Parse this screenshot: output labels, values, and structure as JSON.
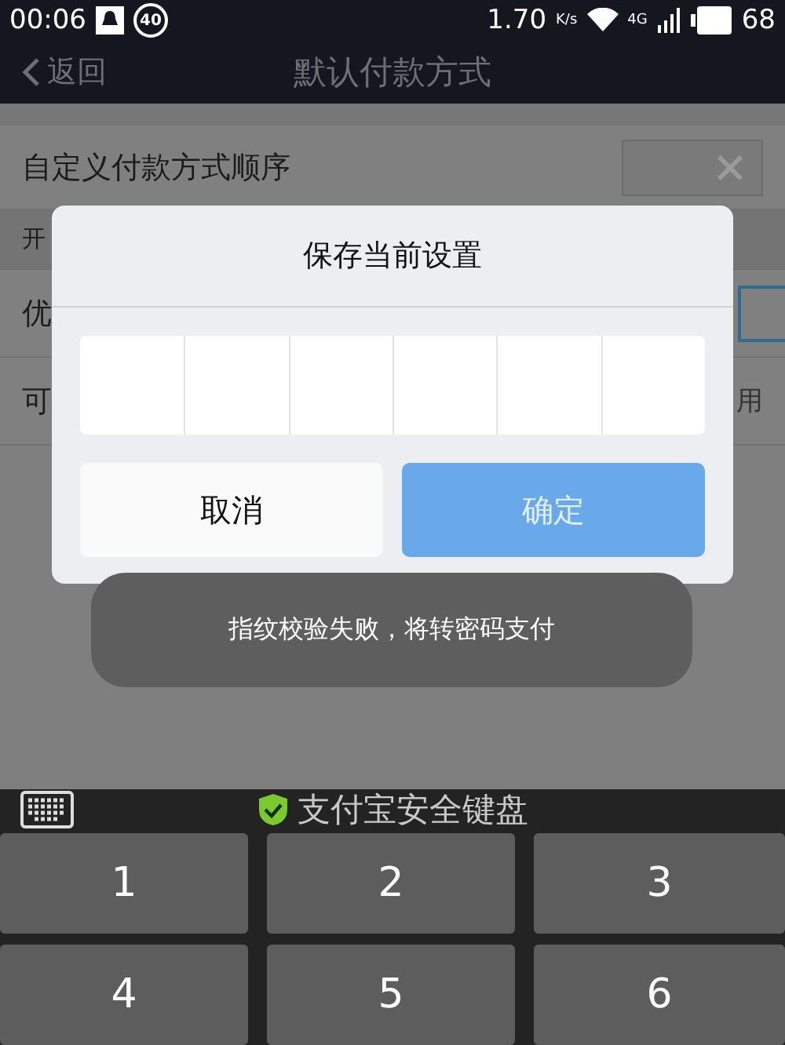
{
  "status_bar": {
    "time": "00:06",
    "badge": "40",
    "speed": "1.70",
    "speed_unit": "K/s",
    "network": "4G",
    "battery": "68"
  },
  "nav": {
    "back": "返回",
    "title": "默认付款方式"
  },
  "settings": [
    {
      "kind": "toggle",
      "label": "自定义付款方式顺序",
      "on": false
    },
    {
      "kind": "hint",
      "label": "开"
    },
    {
      "kind": "field",
      "label": "优"
    },
    {
      "kind": "trailing",
      "label": "可",
      "trailing": "用"
    }
  ],
  "dialog": {
    "title": "保存当前设置",
    "cancel": {
      "label": "取消",
      "disabled": false
    },
    "confirm": {
      "label": "确定",
      "disabled": true
    }
  },
  "toast": "指纹校验失败，将转密码支付",
  "keyboard": {
    "title": "支付宝安全键盘",
    "keys": [
      "1",
      "2",
      "3",
      "4",
      "5",
      "6"
    ]
  }
}
